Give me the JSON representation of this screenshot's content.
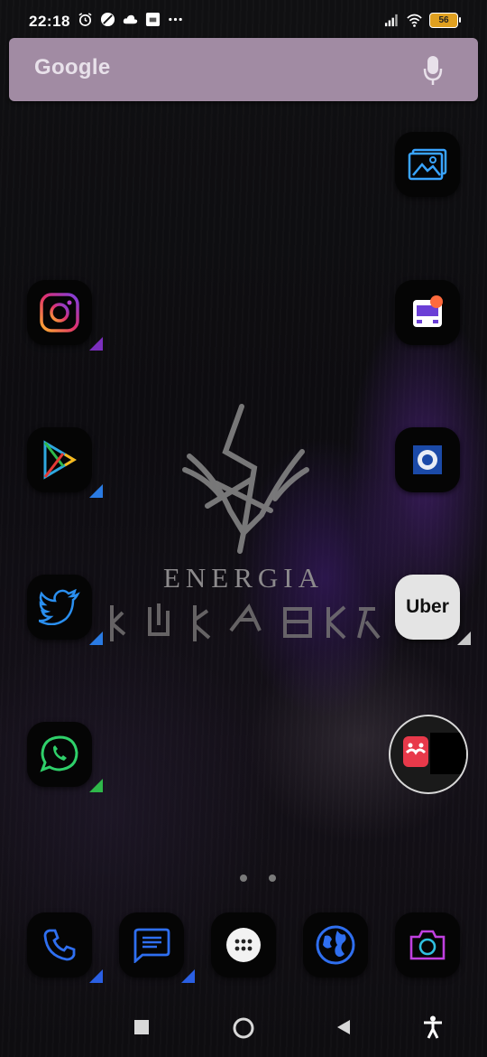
{
  "status_bar": {
    "time": "22:18",
    "battery": "56",
    "left_icons": [
      "alarm-icon",
      "no-disturb-icon",
      "cloud-icon",
      "notification-icon",
      "more-icon"
    ],
    "right_icons": [
      "signal-icon",
      "wifi-icon",
      "battery-icon"
    ]
  },
  "search": {
    "label": "Google",
    "icon": "mic-icon"
  },
  "wallpaper": {
    "title": "ENERGIA"
  },
  "apps": [
    {
      "id": "gallery",
      "icon": "gallery-icon"
    },
    {
      "id": "instagram",
      "icon": "instagram-icon"
    },
    {
      "id": "bus",
      "icon": "bus-icon"
    },
    {
      "id": "play-store",
      "icon": "play-store-icon"
    },
    {
      "id": "seal",
      "icon": "seal-icon"
    },
    {
      "id": "twitter",
      "icon": "twitter-icon"
    },
    {
      "id": "uber",
      "label": "Uber"
    },
    {
      "id": "whatsapp",
      "icon": "whatsapp-icon"
    },
    {
      "id": "floating-bubble",
      "icon": "mask-icon"
    }
  ],
  "dock": [
    "phone-icon",
    "messages-icon",
    "app-drawer-icon",
    "browser-icon",
    "camera-icon"
  ],
  "page_indicator": {
    "pages": 2
  },
  "nav_bar": [
    "recents-icon",
    "home-icon",
    "back-icon",
    "accessibility-icon"
  ],
  "colors": {
    "search_bg": "#a18ba3",
    "accent_blue": "#2a7be3",
    "accent_purple": "#7b2fbe",
    "accent_green": "#2fb84a"
  }
}
